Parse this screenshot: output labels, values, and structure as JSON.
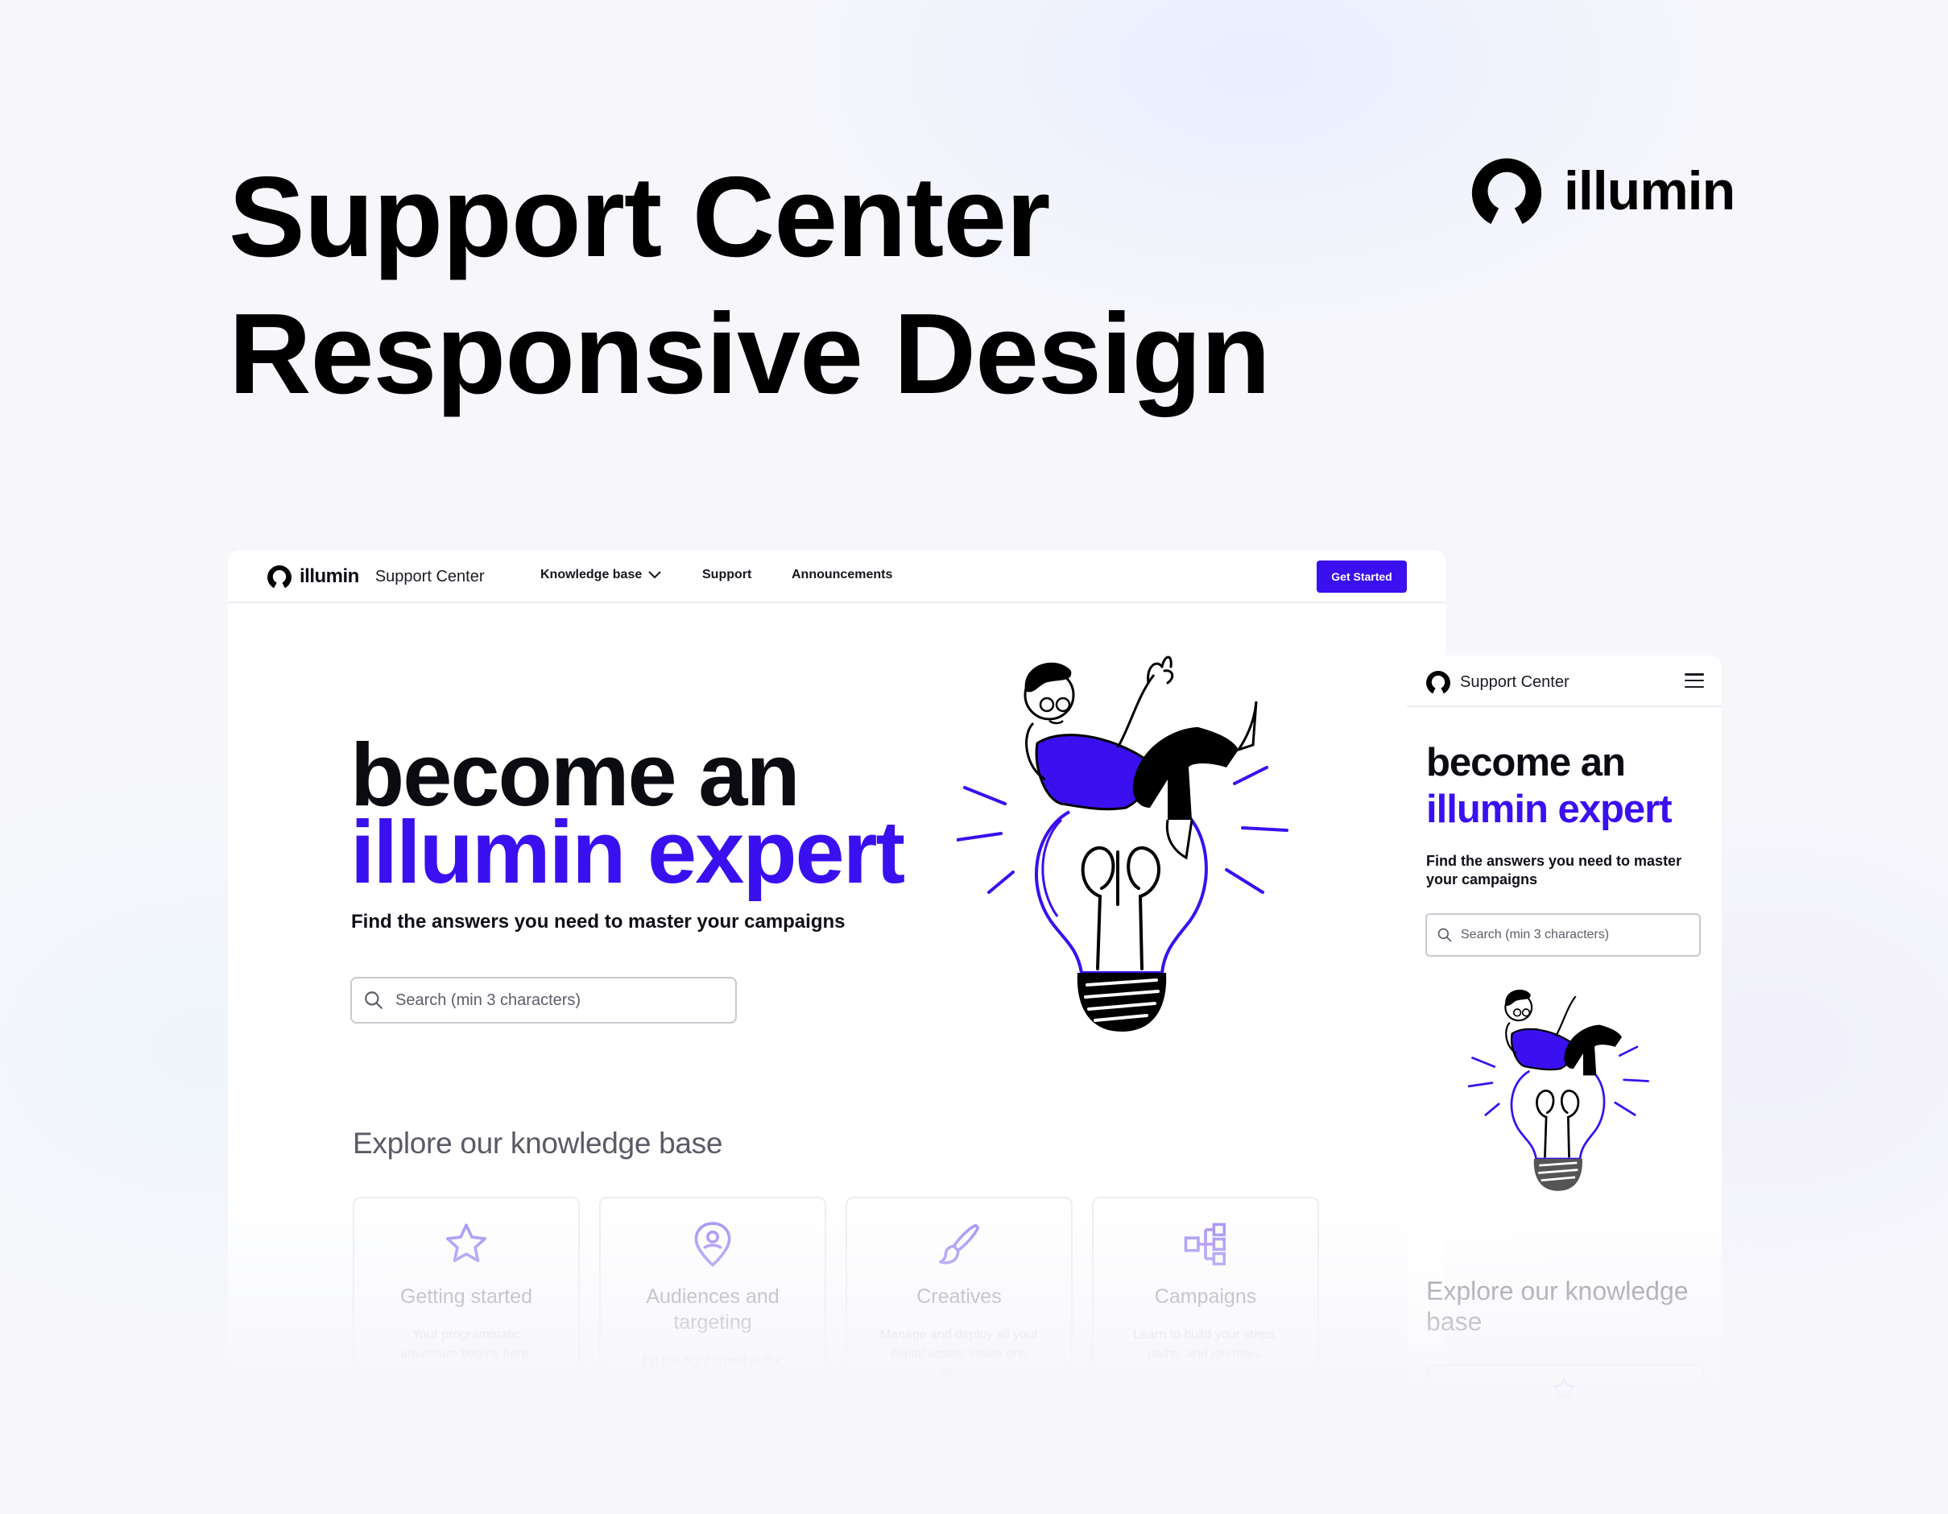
{
  "page": {
    "title_line1": "Support Center",
    "title_line2": "Responsive Design",
    "brand_name": "illumin"
  },
  "desktop": {
    "nav": {
      "logo_text": "illumin",
      "logo_sub": "Support Center",
      "items": [
        "Knowledge base",
        "Support",
        "Announcements"
      ],
      "cta": "Get Started"
    },
    "hero": {
      "line1": "become an",
      "line2": "illumin expert",
      "subtitle": "Find the answers you need to master your campaigns",
      "search_placeholder": "Search (min 3 characters)"
    },
    "kb": {
      "title": "Explore our knowledge base",
      "cards": [
        {
          "title": "Getting started",
          "desc": "Your programmatic adventure begins here.",
          "icon": "star-icon"
        },
        {
          "title": "Audiences and targeting",
          "desc": "Hit the right crowd in the right places.",
          "icon": "location-person-icon"
        },
        {
          "title": "Creatives",
          "desc": "Manage and deploy all your digital assets inside one library.",
          "icon": "paintbrush-icon"
        },
        {
          "title": "Campaigns",
          "desc": "Learn to build your steps, paths, and journeys.",
          "icon": "flow-blocks-icon"
        }
      ]
    }
  },
  "mobile": {
    "nav": {
      "logo_sub": "Support Center"
    },
    "hero": {
      "line1": "become an",
      "line2": "illumin expert",
      "subtitle": "Find the answers you need to master your campaigns",
      "search_placeholder": "Search (min 3 characters)"
    },
    "kb": {
      "title": "Explore our knowledge base"
    }
  },
  "colors": {
    "accent": "#3a10f0",
    "text": "#0b0b12",
    "muted": "#5a5a68",
    "card_icon": "#9b83f4"
  }
}
